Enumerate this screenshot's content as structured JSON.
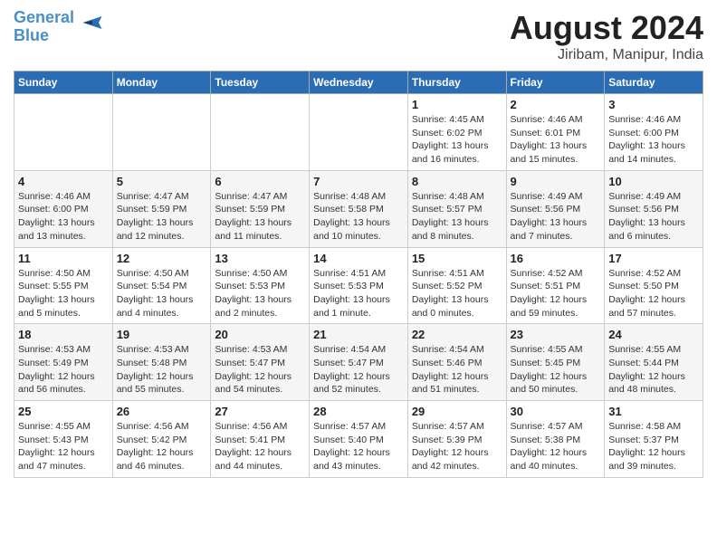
{
  "header": {
    "logo_line1": "General",
    "logo_line2": "Blue",
    "title": "August 2024",
    "subtitle": "Jiribam, Manipur, India"
  },
  "weekdays": [
    "Sunday",
    "Monday",
    "Tuesday",
    "Wednesday",
    "Thursday",
    "Friday",
    "Saturday"
  ],
  "weeks": [
    [
      {
        "day": "",
        "info": ""
      },
      {
        "day": "",
        "info": ""
      },
      {
        "day": "",
        "info": ""
      },
      {
        "day": "",
        "info": ""
      },
      {
        "day": "1",
        "info": "Sunrise: 4:45 AM\nSunset: 6:02 PM\nDaylight: 13 hours\nand 16 minutes."
      },
      {
        "day": "2",
        "info": "Sunrise: 4:46 AM\nSunset: 6:01 PM\nDaylight: 13 hours\nand 15 minutes."
      },
      {
        "day": "3",
        "info": "Sunrise: 4:46 AM\nSunset: 6:00 PM\nDaylight: 13 hours\nand 14 minutes."
      }
    ],
    [
      {
        "day": "4",
        "info": "Sunrise: 4:46 AM\nSunset: 6:00 PM\nDaylight: 13 hours\nand 13 minutes."
      },
      {
        "day": "5",
        "info": "Sunrise: 4:47 AM\nSunset: 5:59 PM\nDaylight: 13 hours\nand 12 minutes."
      },
      {
        "day": "6",
        "info": "Sunrise: 4:47 AM\nSunset: 5:59 PM\nDaylight: 13 hours\nand 11 minutes."
      },
      {
        "day": "7",
        "info": "Sunrise: 4:48 AM\nSunset: 5:58 PM\nDaylight: 13 hours\nand 10 minutes."
      },
      {
        "day": "8",
        "info": "Sunrise: 4:48 AM\nSunset: 5:57 PM\nDaylight: 13 hours\nand 8 minutes."
      },
      {
        "day": "9",
        "info": "Sunrise: 4:49 AM\nSunset: 5:56 PM\nDaylight: 13 hours\nand 7 minutes."
      },
      {
        "day": "10",
        "info": "Sunrise: 4:49 AM\nSunset: 5:56 PM\nDaylight: 13 hours\nand 6 minutes."
      }
    ],
    [
      {
        "day": "11",
        "info": "Sunrise: 4:50 AM\nSunset: 5:55 PM\nDaylight: 13 hours\nand 5 minutes."
      },
      {
        "day": "12",
        "info": "Sunrise: 4:50 AM\nSunset: 5:54 PM\nDaylight: 13 hours\nand 4 minutes."
      },
      {
        "day": "13",
        "info": "Sunrise: 4:50 AM\nSunset: 5:53 PM\nDaylight: 13 hours\nand 2 minutes."
      },
      {
        "day": "14",
        "info": "Sunrise: 4:51 AM\nSunset: 5:53 PM\nDaylight: 13 hours\nand 1 minute."
      },
      {
        "day": "15",
        "info": "Sunrise: 4:51 AM\nSunset: 5:52 PM\nDaylight: 13 hours\nand 0 minutes."
      },
      {
        "day": "16",
        "info": "Sunrise: 4:52 AM\nSunset: 5:51 PM\nDaylight: 12 hours\nand 59 minutes."
      },
      {
        "day": "17",
        "info": "Sunrise: 4:52 AM\nSunset: 5:50 PM\nDaylight: 12 hours\nand 57 minutes."
      }
    ],
    [
      {
        "day": "18",
        "info": "Sunrise: 4:53 AM\nSunset: 5:49 PM\nDaylight: 12 hours\nand 56 minutes."
      },
      {
        "day": "19",
        "info": "Sunrise: 4:53 AM\nSunset: 5:48 PM\nDaylight: 12 hours\nand 55 minutes."
      },
      {
        "day": "20",
        "info": "Sunrise: 4:53 AM\nSunset: 5:47 PM\nDaylight: 12 hours\nand 54 minutes."
      },
      {
        "day": "21",
        "info": "Sunrise: 4:54 AM\nSunset: 5:47 PM\nDaylight: 12 hours\nand 52 minutes."
      },
      {
        "day": "22",
        "info": "Sunrise: 4:54 AM\nSunset: 5:46 PM\nDaylight: 12 hours\nand 51 minutes."
      },
      {
        "day": "23",
        "info": "Sunrise: 4:55 AM\nSunset: 5:45 PM\nDaylight: 12 hours\nand 50 minutes."
      },
      {
        "day": "24",
        "info": "Sunrise: 4:55 AM\nSunset: 5:44 PM\nDaylight: 12 hours\nand 48 minutes."
      }
    ],
    [
      {
        "day": "25",
        "info": "Sunrise: 4:55 AM\nSunset: 5:43 PM\nDaylight: 12 hours\nand 47 minutes."
      },
      {
        "day": "26",
        "info": "Sunrise: 4:56 AM\nSunset: 5:42 PM\nDaylight: 12 hours\nand 46 minutes."
      },
      {
        "day": "27",
        "info": "Sunrise: 4:56 AM\nSunset: 5:41 PM\nDaylight: 12 hours\nand 44 minutes."
      },
      {
        "day": "28",
        "info": "Sunrise: 4:57 AM\nSunset: 5:40 PM\nDaylight: 12 hours\nand 43 minutes."
      },
      {
        "day": "29",
        "info": "Sunrise: 4:57 AM\nSunset: 5:39 PM\nDaylight: 12 hours\nand 42 minutes."
      },
      {
        "day": "30",
        "info": "Sunrise: 4:57 AM\nSunset: 5:38 PM\nDaylight: 12 hours\nand 40 minutes."
      },
      {
        "day": "31",
        "info": "Sunrise: 4:58 AM\nSunset: 5:37 PM\nDaylight: 12 hours\nand 39 minutes."
      }
    ]
  ]
}
